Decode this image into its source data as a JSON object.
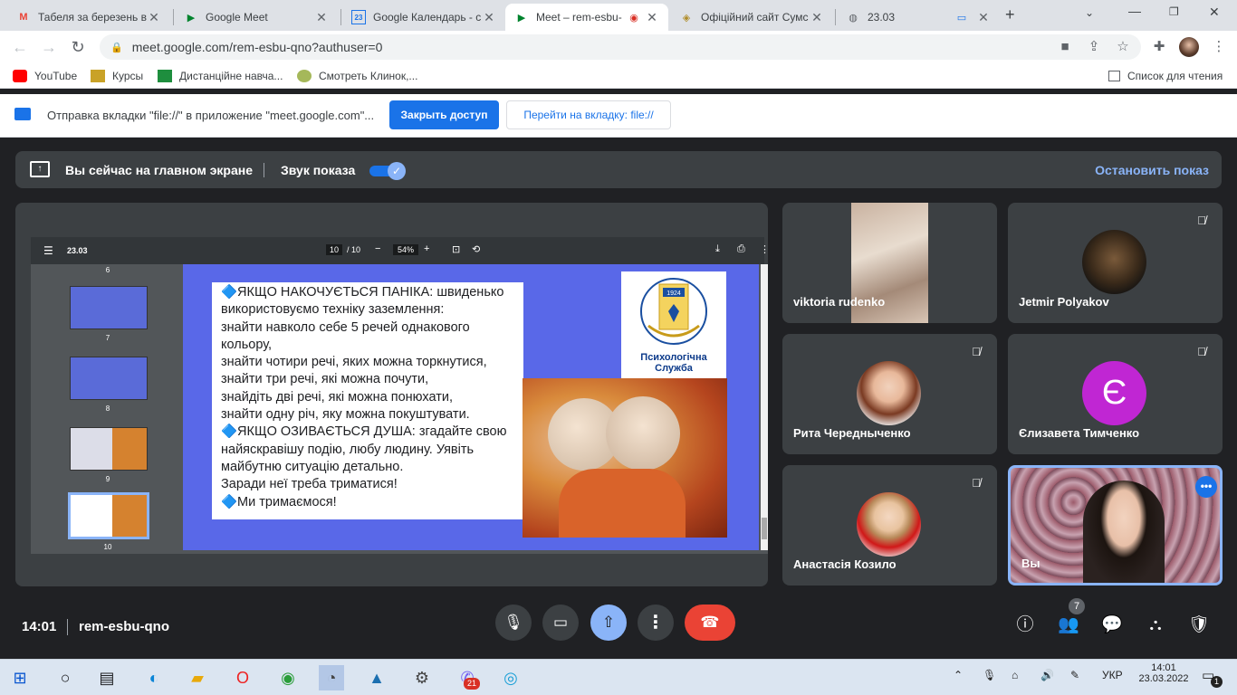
{
  "browser": {
    "tabs": [
      {
        "title": "Табеля за березень в",
        "icon": "gmail-icon"
      },
      {
        "title": "Google Meet",
        "icon": "meet-icon"
      },
      {
        "title": "Google Календарь - с",
        "icon": "calendar-icon"
      },
      {
        "title": "Meet – rem-esbu-",
        "icon": "meet-icon",
        "active": true
      },
      {
        "title": "Офіційний сайт Сумс",
        "icon": "site-icon"
      },
      {
        "title": "23.03",
        "icon": "globe-icon"
      }
    ],
    "url": "meet.google.com/rem-esbu-qno?authuser=0",
    "bookmarks": [
      "YouTube",
      "Курсы",
      "Дистанційне навча...",
      "Смотреть Клинок,..."
    ],
    "reading_list": "Список для чтения"
  },
  "infobar": {
    "message": "Отправка вкладки \"file://\" в приложение \"meet.google.com\"...",
    "close_access": "Закрыть доступ",
    "switch_tab": "Перейти на вкладку: file://"
  },
  "meet": {
    "presenting_label": "Вы сейчас на главном экране",
    "sound_label": "Звук показа",
    "stop_label": "Остановить показ",
    "pdf": {
      "title": "23.03",
      "page": "10",
      "page_total": "/ 10",
      "zoom": "54%",
      "thumb_nums": [
        "6",
        "7",
        "8",
        "9",
        "10"
      ],
      "slide_lines": [
        "🔷ЯКЩО НАКОЧУЄТЬСЯ ПАНІКА: швиденько",
        "використовуємо техніку заземлення:",
        "знайти навколо себе 5 речей однакового",
        "кольору,",
        "знайти чотири речі, яких можна торкнутися,",
        "знайти три речі, які можна почути,",
        "знайдіть дві речі, які можна понюхати,",
        "знайти одну річ, яку можна покуштувати.",
        "🔷ЯКЩО ОЗИВАЄТЬСЯ ДУША: згадайте свою",
        "найяскравішу подію, любу людину. Уявіть",
        "майбутню ситуацію детально.",
        "Заради неї треба триматися!",
        "🔷Ми тримаємося!"
      ],
      "logo_text": "Психологічна Служба",
      "logo_year": "1924"
    },
    "participants": [
      {
        "name": "viktoria rudenko",
        "muted": false
      },
      {
        "name": "Jetmir Polyakov",
        "muted": true
      },
      {
        "name": "Рита Чередныченко",
        "muted": true
      },
      {
        "name": "Єлизавета Тимченко",
        "muted": true,
        "initial": "Є"
      },
      {
        "name": "Анастасія Козило",
        "muted": true
      },
      {
        "name": "Вы",
        "muted": false
      }
    ],
    "time": "14:01",
    "meeting_code": "rem-esbu-qno",
    "participant_count": "7"
  },
  "taskbar": {
    "lang": "УКР",
    "time": "14:01",
    "date": "23.03.2022",
    "viber_badge": "21",
    "notif_badge": "1"
  },
  "colors": {
    "accent": "#1a73e8",
    "end_call": "#ea4335",
    "meet_bg": "#202124",
    "tile_bg": "#3c4043",
    "slide_bg": "#5968e8"
  }
}
